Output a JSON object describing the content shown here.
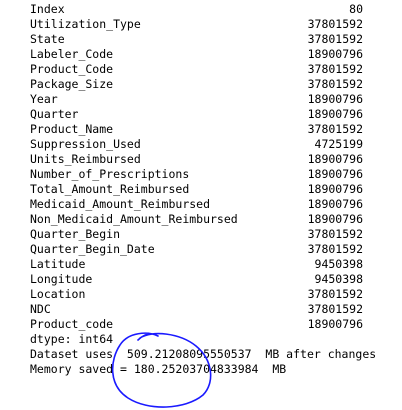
{
  "series": [
    {
      "name": "Index",
      "value": "80"
    },
    {
      "name": "Utilization_Type",
      "value": "37801592"
    },
    {
      "name": "State",
      "value": "37801592"
    },
    {
      "name": "Labeler_Code",
      "value": "18900796"
    },
    {
      "name": "Product_Code",
      "value": "37801592"
    },
    {
      "name": "Package_Size",
      "value": "37801592"
    },
    {
      "name": "Year",
      "value": "18900796"
    },
    {
      "name": "Quarter",
      "value": "18900796"
    },
    {
      "name": "Product_Name",
      "value": "37801592"
    },
    {
      "name": "Suppression_Used",
      "value": "4725199"
    },
    {
      "name": "Units_Reimbursed",
      "value": "18900796"
    },
    {
      "name": "Number_of_Prescriptions",
      "value": "18900796"
    },
    {
      "name": "Total_Amount_Reimbursed",
      "value": "18900796"
    },
    {
      "name": "Medicaid_Amount_Reimbursed",
      "value": "18900796"
    },
    {
      "name": "Non_Medicaid_Amount_Reimbursed",
      "value": "18900796"
    },
    {
      "name": "Quarter_Begin",
      "value": "37801592"
    },
    {
      "name": "Quarter_Begin_Date",
      "value": "37801592"
    },
    {
      "name": "Latitude",
      "value": "9450398"
    },
    {
      "name": "Longitude",
      "value": "9450398"
    },
    {
      "name": "Location",
      "value": "37801592"
    },
    {
      "name": "NDC",
      "value": "37801592"
    },
    {
      "name": "Product_code",
      "value": "18900796"
    }
  ],
  "dtype_line": "dtype: int64",
  "dataset_line": "Dataset uses  509.21208095550537  MB after changes",
  "memory_line": "Memory saved = 180.25203704833984  MB",
  "annotation": {
    "color": "#1a1aff"
  }
}
